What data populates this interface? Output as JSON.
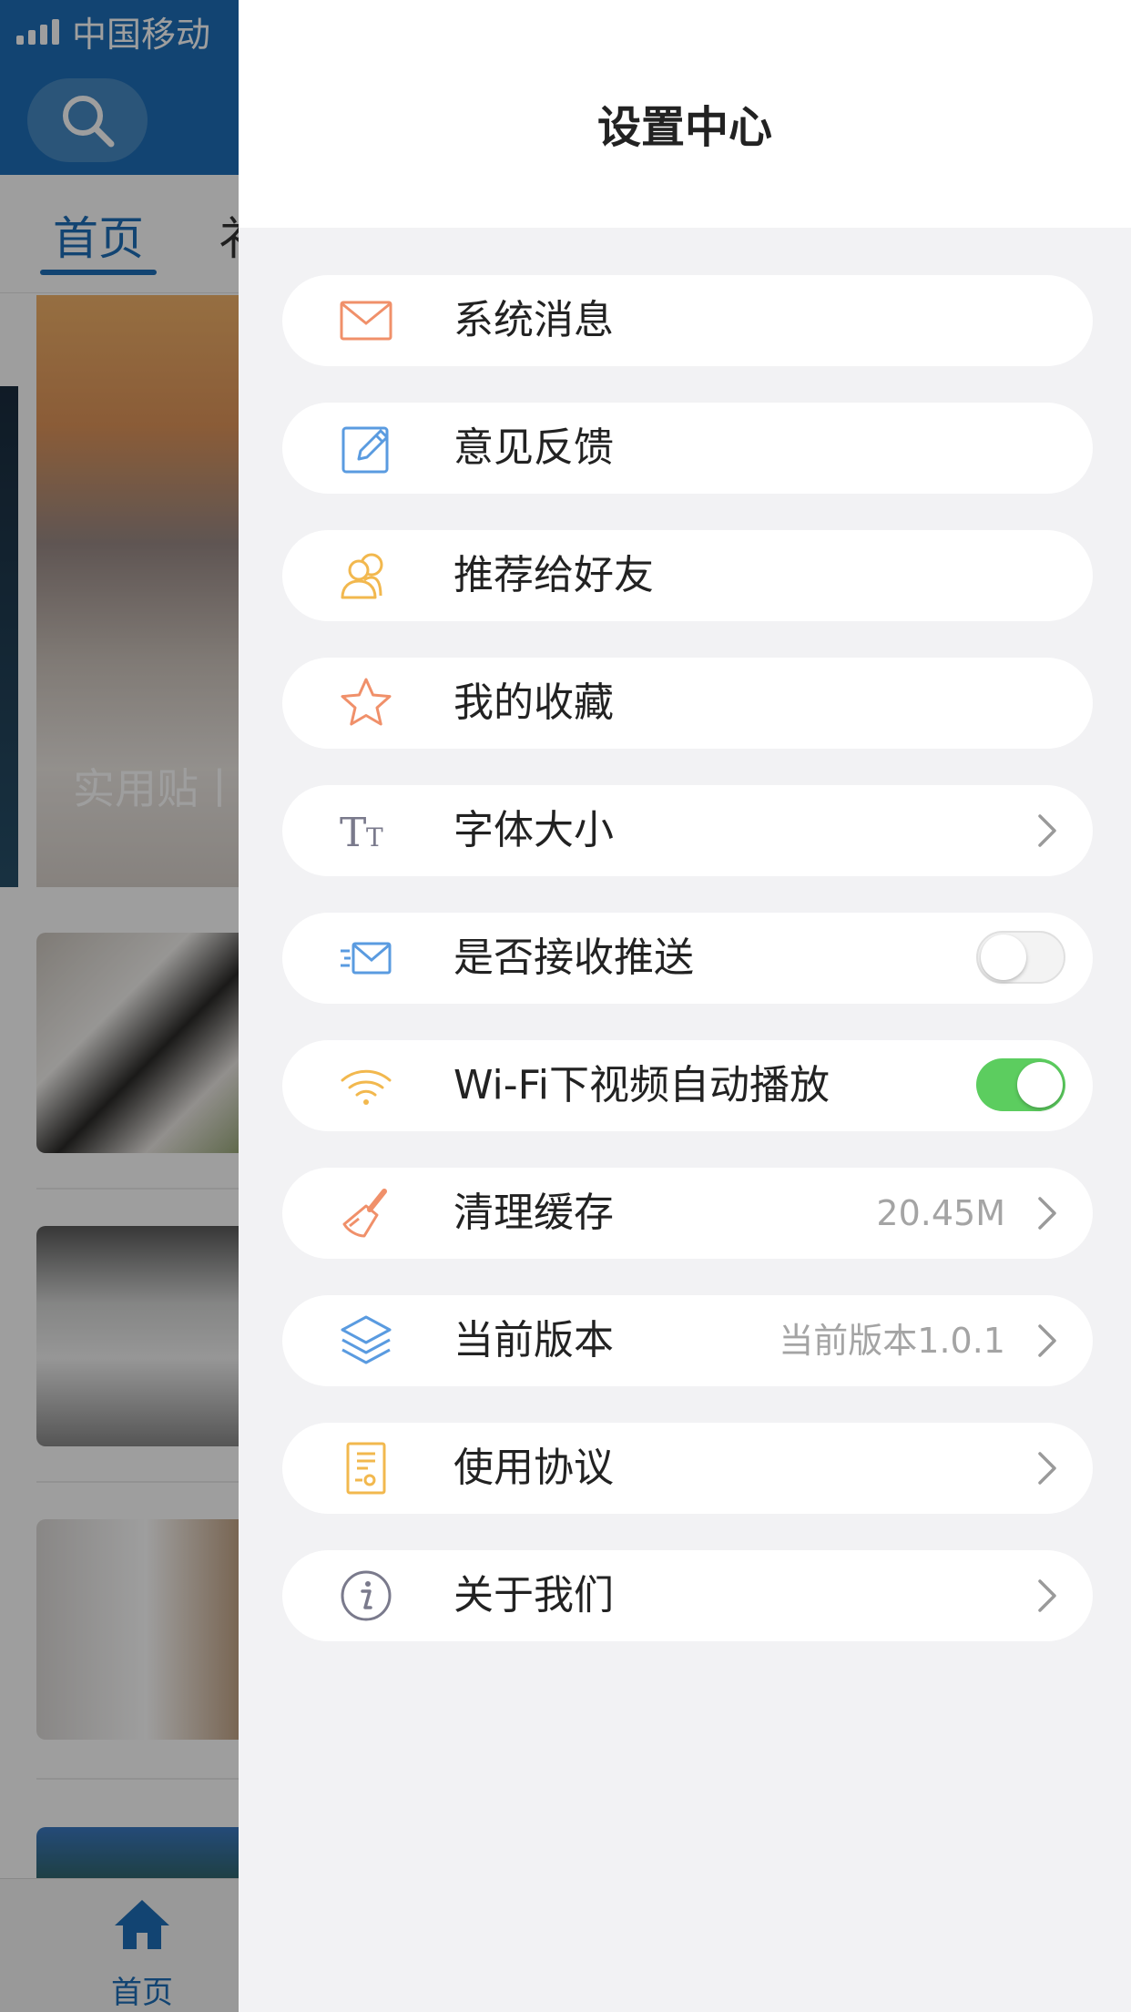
{
  "status_bar": {
    "carrier": "中国移动"
  },
  "background": {
    "tab_home": "首页",
    "tab_next": "衤",
    "feature_caption": "实用贴丨“",
    "bottom_nav_home": "首页"
  },
  "settings": {
    "title": "设置中心",
    "items": [
      {
        "label": "系统消息",
        "icon": "mail-icon",
        "accessory": "none"
      },
      {
        "label": "意见反馈",
        "icon": "edit-icon",
        "accessory": "none"
      },
      {
        "label": "推荐给好友",
        "icon": "users-icon",
        "accessory": "none"
      },
      {
        "label": "我的收藏",
        "icon": "star-icon",
        "accessory": "none"
      },
      {
        "label": "字体大小",
        "icon": "font-size-icon",
        "accessory": "chevron"
      },
      {
        "label": "是否接收推送",
        "icon": "push-mail-icon",
        "accessory": "toggle",
        "toggle_on": false
      },
      {
        "label": "Wi-Fi下视频自动播放",
        "icon": "wifi-icon",
        "accessory": "toggle",
        "toggle_on": true
      },
      {
        "label": "清理缓存",
        "icon": "brush-icon",
        "accessory": "chevron",
        "value": "20.45M"
      },
      {
        "label": "当前版本",
        "icon": "layers-icon",
        "accessory": "chevron",
        "value": "当前版本1.0.1"
      },
      {
        "label": "使用协议",
        "icon": "document-icon",
        "accessory": "chevron"
      },
      {
        "label": "关于我们",
        "icon": "info-icon",
        "accessory": "chevron"
      }
    ]
  },
  "colors": {
    "brand_blue": "#1e6fb8",
    "toggle_on": "#5ccd5f",
    "icon_orange": "#f0906a",
    "icon_blue": "#5a9be0",
    "icon_yellow": "#f2b84e",
    "icon_gray": "#7a7a8c"
  }
}
